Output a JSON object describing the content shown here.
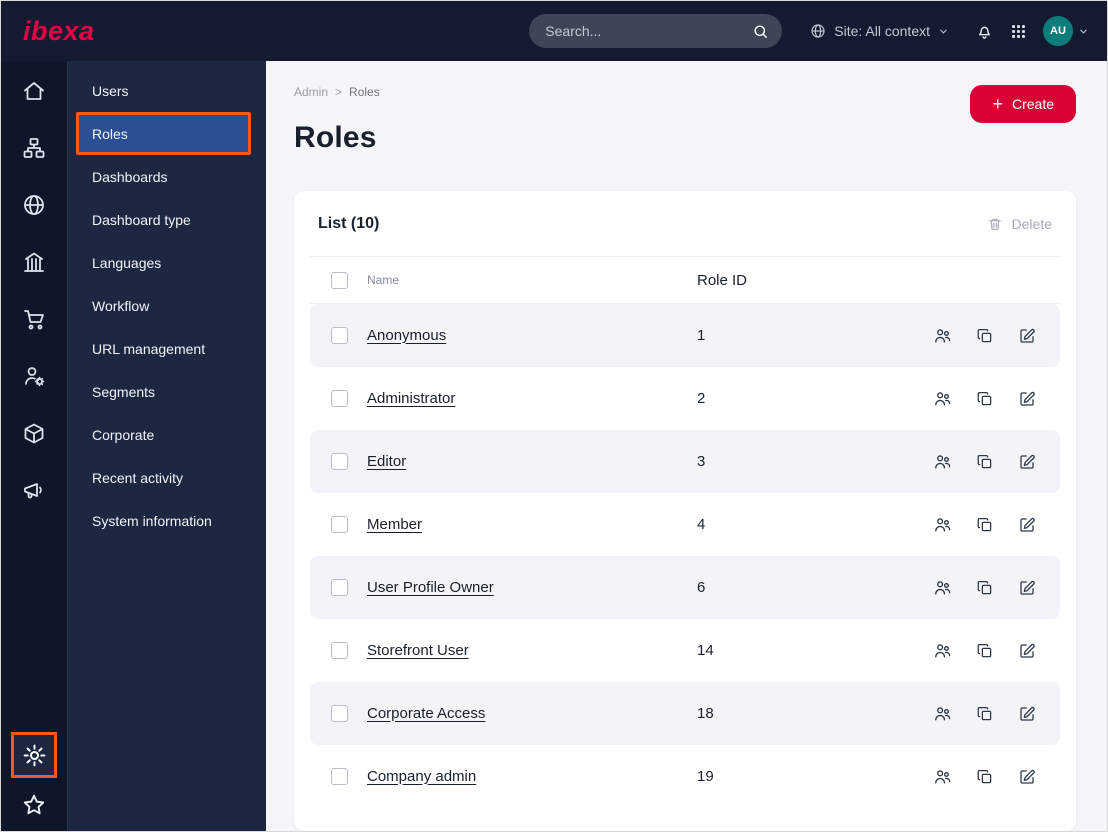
{
  "topbar": {
    "logo_text": "ibexa",
    "search_placeholder": "Search...",
    "site_context_label": "Site: All context",
    "avatar_initials": "AU"
  },
  "rail": {
    "icons": [
      "home-icon",
      "site-structure-icon",
      "globe-icon",
      "building-icon",
      "cart-icon",
      "customer-settings-icon",
      "package-icon",
      "megaphone-icon"
    ],
    "bottom_icons": [
      "settings-gear-icon",
      "star-icon"
    ]
  },
  "sidebar": {
    "items": [
      {
        "label": "Users",
        "active": false
      },
      {
        "label": "Roles",
        "active": true
      },
      {
        "label": "Dashboards",
        "active": false
      },
      {
        "label": "Dashboard type",
        "active": false
      },
      {
        "label": "Languages",
        "active": false
      },
      {
        "label": "Workflow",
        "active": false
      },
      {
        "label": "URL management",
        "active": false
      },
      {
        "label": "Segments",
        "active": false
      },
      {
        "label": "Corporate",
        "active": false
      },
      {
        "label": "Recent activity",
        "active": false
      },
      {
        "label": "System information",
        "active": false
      }
    ]
  },
  "main": {
    "breadcrumb": [
      "Admin",
      "Roles"
    ],
    "breadcrumb_separator": ">",
    "title": "Roles",
    "create_label": "Create",
    "card": {
      "list_title": "List (10)",
      "delete_label": "Delete",
      "columns": {
        "name": "Name",
        "role_id": "Role ID"
      },
      "rows": [
        {
          "name": "Anonymous",
          "role_id": "1"
        },
        {
          "name": "Administrator",
          "role_id": "2"
        },
        {
          "name": "Editor",
          "role_id": "3"
        },
        {
          "name": "Member",
          "role_id": "4"
        },
        {
          "name": "User Profile Owner",
          "role_id": "6"
        },
        {
          "name": "Storefront User",
          "role_id": "14"
        },
        {
          "name": "Corporate Access",
          "role_id": "18"
        },
        {
          "name": "Company admin",
          "role_id": "19"
        }
      ]
    }
  },
  "colors": {
    "accent_orange": "#f4591d",
    "create_red": "#d80237",
    "active_blue": "#2a5093",
    "avatar_teal": "#0e7c7b",
    "topbar_navy": "#141b30"
  }
}
